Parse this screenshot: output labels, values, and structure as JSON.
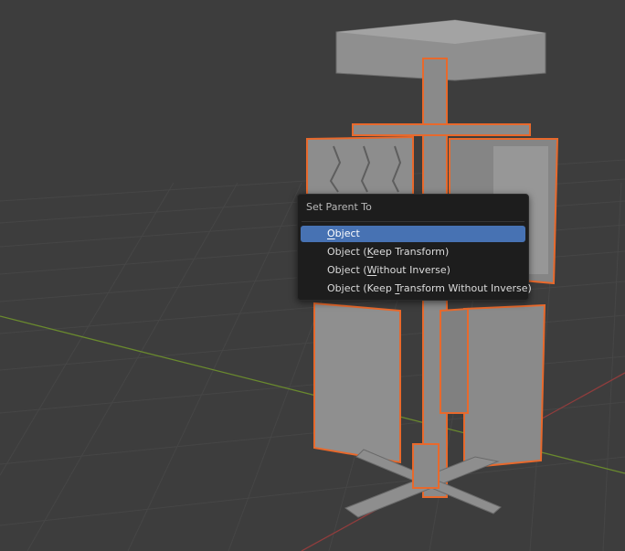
{
  "context_menu": {
    "title": "Set Parent To",
    "items": [
      {
        "pre": "",
        "key": "O",
        "post": "bject",
        "active": true
      },
      {
        "pre": "Object (",
        "key": "K",
        "post": "eep Transform)",
        "active": false
      },
      {
        "pre": "Object (",
        "key": "W",
        "post": "ithout Inverse)",
        "active": false
      },
      {
        "pre": "Object (Keep ",
        "key": "T",
        "post": "ransform Without Inverse)",
        "active": false
      }
    ]
  },
  "colors": {
    "viewport_bg": "#3d3d3d",
    "grid_line": "#454545",
    "x_axis": "#8a3b3b",
    "y_axis": "#62802c",
    "selection_outline": "#e8692c",
    "mesh_gray": "#8c8c8c",
    "menu_bg": "#1d1d1d",
    "menu_highlight": "#4772b3"
  }
}
